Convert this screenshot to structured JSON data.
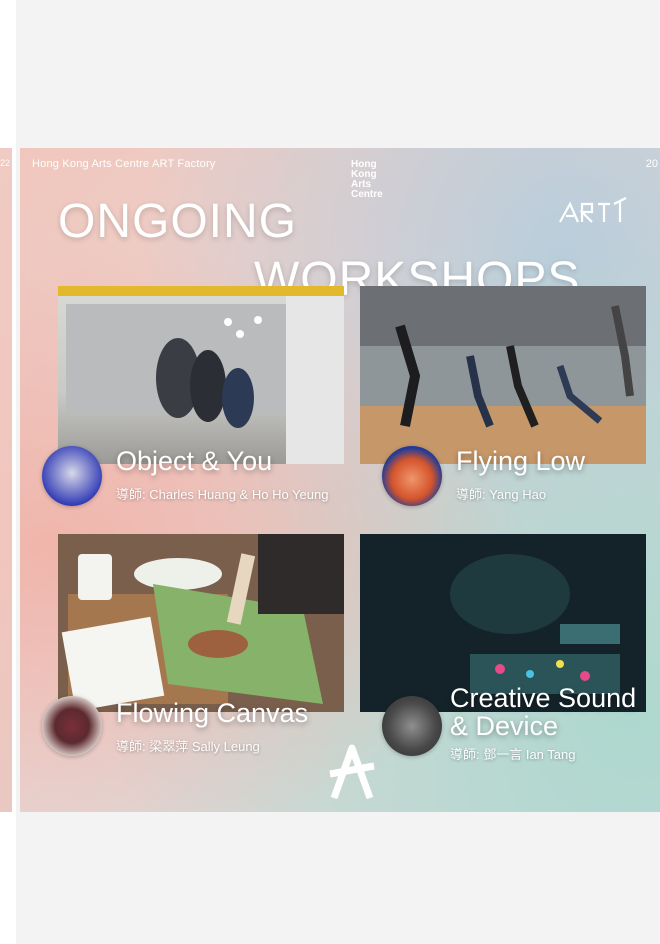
{
  "prev_slide": {
    "peek_text": "22"
  },
  "poster": {
    "org_line": "Hong Kong Arts Centre ART Factory",
    "corner_number": "20",
    "hkac_logo": [
      "Hong",
      "Kong",
      "Arts",
      "Centre"
    ],
    "heading_line1": "ONGOING",
    "heading_line2": "WORKSHOPS",
    "workshops": [
      {
        "title": "Object & You",
        "tutor": "導師: Charles Huang & Ho Ho Yeung"
      },
      {
        "title": "Flying Low",
        "tutor": "導師: Yang Hao"
      },
      {
        "title": "Flowing Canvas",
        "tutor": "導師: 梁翠萍 Sally Leung"
      },
      {
        "title_line1": "Creative Sound",
        "title_line2": "& Device",
        "tutor": "導師: 鄧一言 Ian Tang"
      }
    ]
  },
  "icons": [
    "art-factory-logo-icon",
    "hong-kong-arts-centre-logo-icon",
    "a-logo-icon"
  ]
}
